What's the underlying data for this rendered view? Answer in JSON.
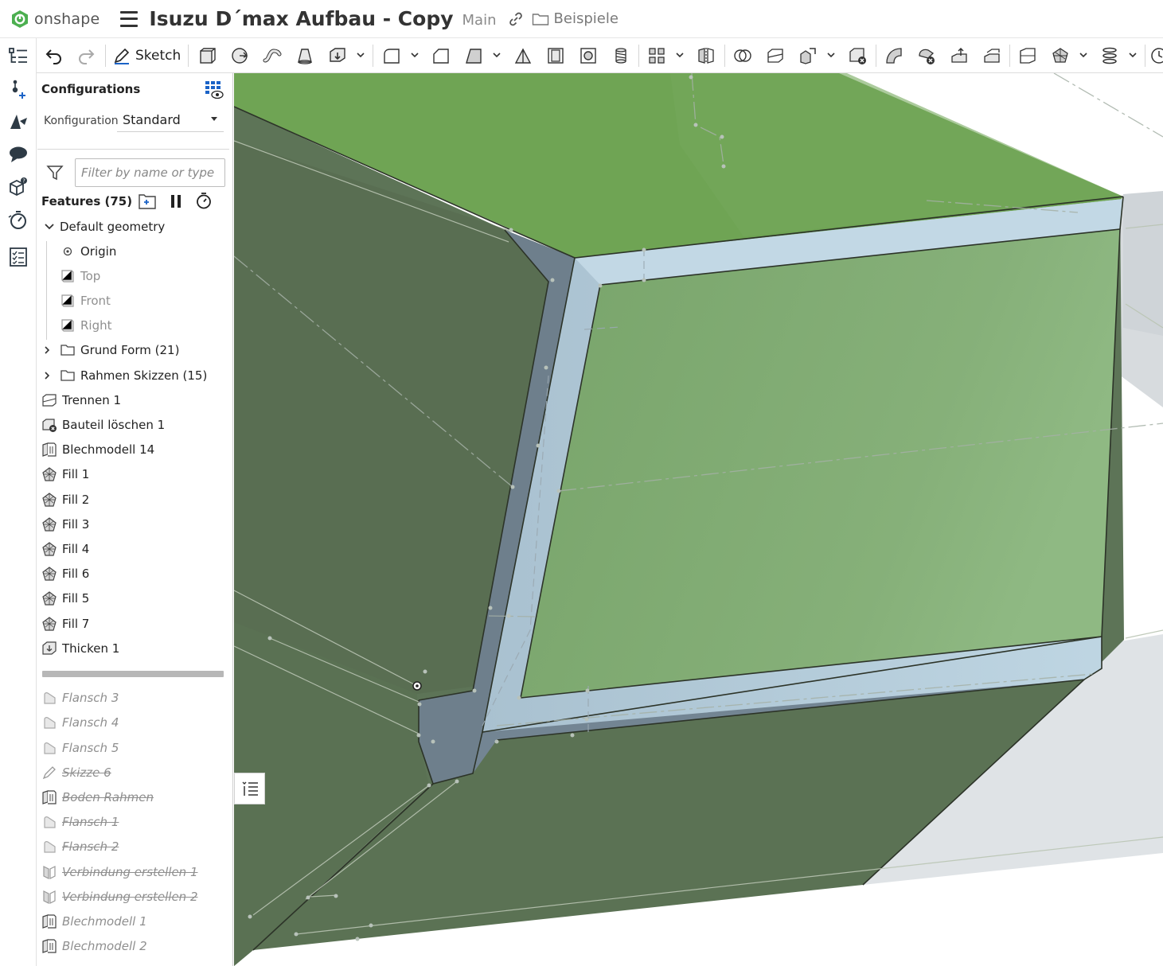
{
  "app": {
    "brand": "onshape",
    "brand_color": "#4caf50"
  },
  "header": {
    "document_title": "Isuzu D´max Aufbau - Copy",
    "branch": "Main",
    "folder": "Beispiele",
    "icons": [
      "hamburger-menu-icon",
      "link-icon",
      "folder-icon"
    ]
  },
  "toolbar": {
    "sketch_label": "Sketch",
    "icons": [
      "undo-icon",
      "redo-icon",
      "sketch-pencil-icon",
      "extrude-icon",
      "revolve-icon",
      "sweep-icon",
      "loft-icon",
      "thicken-icon",
      "fillet-icon",
      "chamfer-icon",
      "draft-icon",
      "rib-icon",
      "shell-icon",
      "hole-icon",
      "thread-icon",
      "pattern-icon",
      "mirror-icon",
      "boolean-icon",
      "split-icon",
      "transform-icon",
      "delete-part-icon",
      "modify-fillet-icon",
      "delete-face-icon",
      "move-face-icon",
      "replace-face-icon",
      "plane-icon",
      "fill-surface-icon",
      "helix-icon",
      "more-icon"
    ]
  },
  "rail": {
    "icons": [
      "feature-list-icon",
      "insert-mate-icon",
      "appearance-icon",
      "comment-icon",
      "part-info-icon",
      "timer-icon",
      "checklist-icon"
    ]
  },
  "panel": {
    "configurations_title": "Configurations",
    "configuration_label": "Konfiguration",
    "configuration_value": "Standard",
    "filter_placeholder": "Filter by name or type",
    "features_title": "Features (75)",
    "tree": [
      {
        "label": "Default geometry",
        "type": "group-open",
        "icon": "chevron-down-icon"
      },
      {
        "label": "Origin",
        "type": "origin",
        "icon": "origin-icon"
      },
      {
        "label": "Top",
        "type": "plane",
        "icon": "plane-icon"
      },
      {
        "label": "Front",
        "type": "plane",
        "icon": "plane-icon"
      },
      {
        "label": "Right",
        "type": "plane",
        "icon": "plane-icon"
      },
      {
        "label": "Grund Form (21)",
        "type": "folder",
        "icon": "folder-icon"
      },
      {
        "label": "Rahmen Skizzen (15)",
        "type": "folder",
        "icon": "folder-icon"
      },
      {
        "label": "Trennen 1",
        "type": "feature",
        "icon": "split-icon"
      },
      {
        "label": "Bauteil löschen 1",
        "type": "feature",
        "icon": "delete-part-icon"
      },
      {
        "label": "Blechmodell 14",
        "type": "feature",
        "icon": "sheet-metal-icon"
      },
      {
        "label": "Fill 1",
        "type": "feature",
        "icon": "fill-icon"
      },
      {
        "label": "Fill 2",
        "type": "feature",
        "icon": "fill-icon"
      },
      {
        "label": "Fill 3",
        "type": "feature",
        "icon": "fill-icon"
      },
      {
        "label": "Fill 4",
        "type": "feature",
        "icon": "fill-icon"
      },
      {
        "label": "Fill 6",
        "type": "feature",
        "icon": "fill-icon"
      },
      {
        "label": "Fill 5",
        "type": "feature",
        "icon": "fill-icon"
      },
      {
        "label": "Fill 7",
        "type": "feature",
        "icon": "fill-icon"
      },
      {
        "label": "Thicken 1",
        "type": "feature",
        "icon": "thicken-icon"
      },
      {
        "label": "Flansch 3",
        "type": "rolled",
        "icon": "flange-icon"
      },
      {
        "label": "Flansch 4",
        "type": "rolled",
        "icon": "flange-icon"
      },
      {
        "label": "Flansch 5",
        "type": "rolled",
        "icon": "flange-icon"
      },
      {
        "label": "Skizze 6",
        "type": "suppressed",
        "icon": "sketch-icon"
      },
      {
        "label": "Boden Rahmen",
        "type": "suppressed",
        "icon": "sheet-metal-icon"
      },
      {
        "label": "Flansch 1",
        "type": "suppressed",
        "icon": "flange-icon"
      },
      {
        "label": "Flansch 2",
        "type": "suppressed",
        "icon": "flange-icon"
      },
      {
        "label": "Verbindung erstellen 1",
        "type": "suppressed",
        "icon": "joint-icon"
      },
      {
        "label": "Verbindung erstellen 2",
        "type": "suppressed",
        "icon": "joint-icon"
      },
      {
        "label": "Blechmodell 1",
        "type": "rolled",
        "icon": "sheet-metal-icon"
      },
      {
        "label": "Blechmodell 2",
        "type": "rolled",
        "icon": "sheet-metal-icon"
      }
    ]
  },
  "viewport": {
    "colors": {
      "top_face": "#6fa454",
      "panel_face": "#84ad76",
      "side_face": "#5d7457",
      "frame": "#b5cbd8",
      "frame_edge": "#6e7f8c",
      "background_part": "#dde1e4"
    }
  }
}
